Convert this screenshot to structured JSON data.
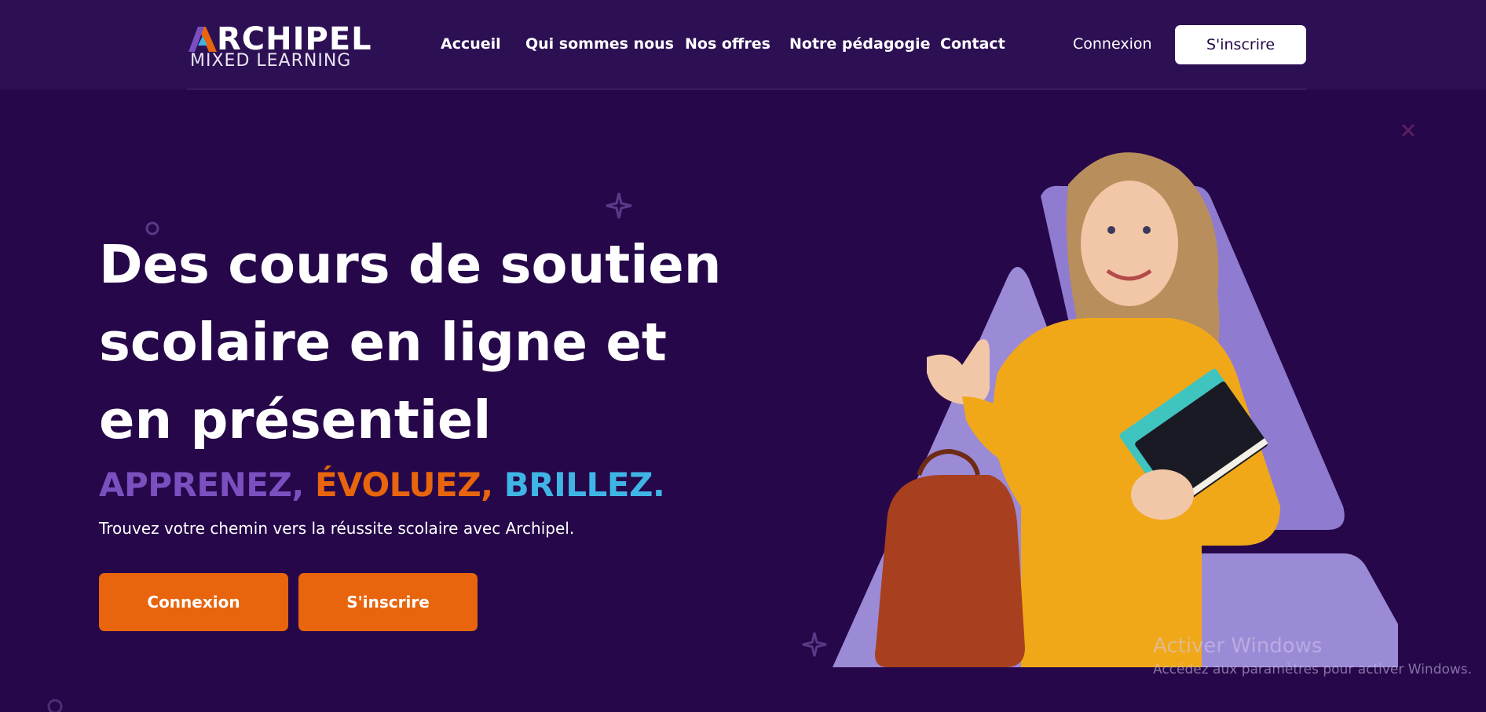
{
  "brand": {
    "name_top_rest": "RCHIPEL",
    "name_bottom": "MIXED LEARNING",
    "colors": {
      "purple": "#7b4fc0",
      "orange": "#e8650d",
      "cyan": "#3fb5e6"
    }
  },
  "nav": {
    "items": [
      "Accueil",
      "Qui sommes nous",
      "Nos offres",
      "Notre pédagogie",
      "Contact"
    ],
    "login_label": "Connexion",
    "signup_label": "S'inscrire"
  },
  "hero": {
    "title": "Des cours de soutien scolaire en ligne et en présentiel",
    "slogan": [
      "APPRENEZ,",
      "ÉVOLUEZ,",
      "BRILLEZ."
    ],
    "slogan_colors": [
      "#7b4fc0",
      "#e8650d",
      "#3fb5e6"
    ],
    "subtitle": "Trouvez votre chemin vers la réussite scolaire avec Archipel.",
    "login_button": "Connexion",
    "signup_button": "S'inscrire"
  },
  "illustration": {
    "description_icon": "student-with-books-image",
    "shape_color": "#9b8ad6"
  },
  "windows_watermark": {
    "title": "Activer Windows",
    "subtitle": "Accédez aux paramètres pour activer Windows."
  }
}
